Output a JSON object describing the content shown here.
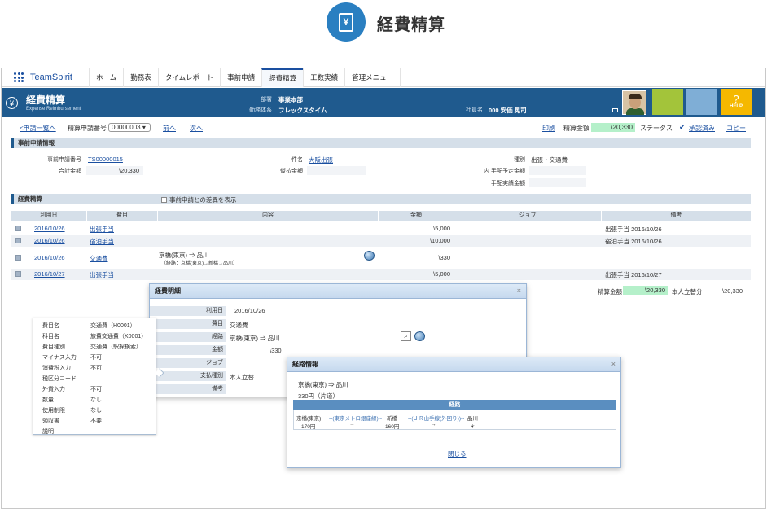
{
  "hero": {
    "title": "経費精算",
    "icon": "yen-receipt-icon",
    "icon_text": "¥"
  },
  "nav": {
    "brand": "TeamSpirit",
    "items": [
      "ホーム",
      "勤務表",
      "タイムレポート",
      "事前申請",
      "経費精算",
      "工数実績",
      "管理メニュー"
    ],
    "active": "経費精算"
  },
  "header": {
    "title": "経費精算",
    "subtitle": "Expense Reimbursement",
    "icon_text": "¥",
    "dept_label": "部署",
    "dept": "事業本部",
    "work_label": "勤務体系",
    "work": "フレックスタイム",
    "emp_label": "社員名",
    "emp": "000 安価 晃司",
    "help": "HELP",
    "help_icon": "?",
    "colors": {
      "header": "#1f5a8e",
      "tile_green": "#a3c43a",
      "tile_blue": "#7faed6",
      "tile_help": "#f5b800"
    }
  },
  "toolbar": {
    "back": "<申請一覧へ",
    "seq_label": "精算申請番号",
    "seq": "00000003",
    "prev": "前へ",
    "next": "次へ",
    "print": "印刷",
    "amount_label": "精算金額",
    "amount": "\\20,330",
    "status_label": "ステータス",
    "status": "承認済み",
    "copy": "コピー"
  },
  "pre": {
    "section": "事前申請情報",
    "no_label": "事前申請番号",
    "no": "TS00000015",
    "total_label": "合計金額",
    "total": "\\20,330",
    "subject_label": "件名",
    "subject": "大阪出張",
    "advance_label": "仮払金額",
    "advance": "",
    "kind_label": "種別",
    "kind": "出張・交通費",
    "plan_label": "内 手配予定金額",
    "plan": "",
    "actual_label": "手配実績金額",
    "actual": ""
  },
  "exp": {
    "section": "経費精算",
    "diff_label": "事前申請との差異を表示",
    "columns": [
      "利用日",
      "費目",
      "内容",
      "金額",
      "ジョブ",
      "備考"
    ],
    "rows": [
      {
        "date": "2016/10/26",
        "item": "出張手当",
        "content": "",
        "content2": "",
        "amount": "\\5,000",
        "job": "",
        "note": "出張手当 2016/10/26"
      },
      {
        "date": "2016/10/26",
        "item": "宿泊手当",
        "content": "",
        "content2": "",
        "amount": "\\10,000",
        "job": "",
        "note": "宿泊手当 2016/10/26"
      },
      {
        "date": "2016/10/26",
        "item": "交通費",
        "content": "京橋(東京) ⇒ 品川",
        "content2": "（経路：京橋(東京)→新橋→品川）",
        "amount": "\\330",
        "job": "",
        "note": ""
      },
      {
        "date": "2016/10/27",
        "item": "出張手当",
        "content": "",
        "content2": "",
        "amount": "\\5,000",
        "job": "",
        "note": "出張手当 2016/10/27"
      }
    ],
    "total_label": "精算金額",
    "total": "\\20,330",
    "self_label": "本人立替分",
    "self": "\\20,330"
  },
  "popup": {
    "rows": [
      [
        "費目名",
        "交通費（H0001）"
      ],
      [
        "科目名",
        "旅費交通費（K0001）"
      ],
      [
        "費目種別",
        "交通費（駅探検索）"
      ],
      [
        "マイナス入力",
        "不可"
      ],
      [
        "消費税入力",
        "不可"
      ],
      [
        "税区分コード",
        ""
      ],
      [
        "外貨入力",
        "不可"
      ],
      [
        "数量",
        "なし"
      ],
      [
        "使用制限",
        "なし"
      ],
      [
        "領収書",
        "不要"
      ],
      [
        "説明",
        ""
      ]
    ]
  },
  "detail": {
    "title": "経費明細",
    "close": "×",
    "rows": [
      [
        "利用日",
        "2016/10/26"
      ],
      [
        "費目",
        "交通費"
      ],
      [
        "経路",
        "京橋(東京) ⇒ 品川"
      ],
      [
        "金額",
        "\\330"
      ],
      [
        "ジョブ",
        ""
      ],
      [
        "支払種別",
        "本人立替"
      ],
      [
        "備考",
        ""
      ]
    ]
  },
  "route": {
    "title": "経路情報",
    "close": "×",
    "line1": "京橋(東京) ⇒ 品川",
    "line2": "330円（片道）",
    "head": "経路",
    "s1": "京橋(東京)",
    "l1": "--(東京メトロ銀座線)--",
    "s2": "新橋",
    "l2": "--(ＪＲ山手線(外回り))--",
    "s3": "品川",
    "f1": "170円",
    "a1": "→",
    "f2": "160円",
    "a2": "→",
    "end": "＊",
    "close_link": "閉じる"
  }
}
